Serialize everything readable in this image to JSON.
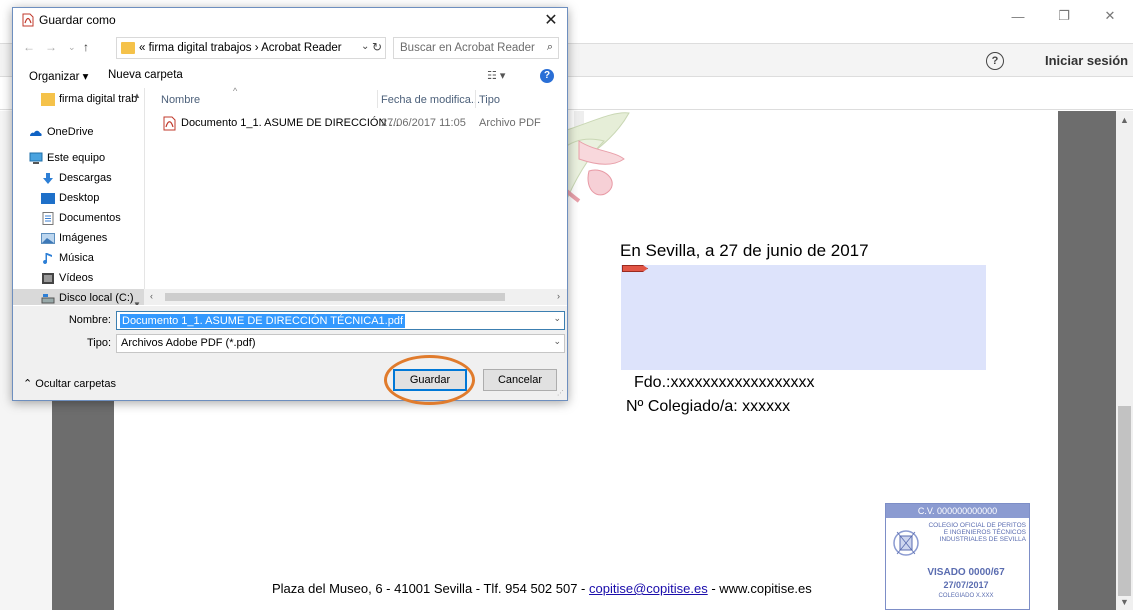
{
  "app": {
    "signin_label": "Iniciar sesión",
    "help_glyph": "?",
    "window_controls": [
      "—",
      "❐",
      "✕"
    ]
  },
  "document": {
    "place_date": "En Sevilla, a 27 de junio de 2017",
    "signature_line": "Fdo.:xxxxxxxxxxxxxxxxxx",
    "colegiado_line": "Nº Colegiado/a: xxxxxx",
    "footer_address": "Plaza del Museo, 6  -  41001 Sevilla  -  Tlf. 954 502 507  - ",
    "footer_email": "copitise@copitise.es",
    "footer_web": " -  www.copitise.es",
    "stamp": {
      "cv": "C.V. 000000000000",
      "college": "COLEGIO OFICIAL DE PERITOS E INGENIEROS TÉCNICOS INDUSTRIALES DE SEVILLA",
      "visado": "VISADO 0000/67",
      "date": "27/07/2017",
      "colegiado": "COLEGIADO X.XXX"
    }
  },
  "dialog": {
    "title": "Guardar como",
    "close_glyph": "✕",
    "path": "«  firma digital trabajos  ›  Acrobat Reader",
    "search_placeholder": "Buscar en Acrobat Reader",
    "organize_label": "Organizar ▾",
    "new_folder_label": "Nueva carpeta",
    "view_label": "☷ ▾",
    "nav_items": [
      {
        "label": "firma digital trab"
      },
      {
        "label": "OneDrive"
      },
      {
        "label": "Este equipo"
      },
      {
        "label": "Descargas"
      },
      {
        "label": "Desktop"
      },
      {
        "label": "Documentos"
      },
      {
        "label": "Imágenes"
      },
      {
        "label": "Música"
      },
      {
        "label": "Vídeos"
      },
      {
        "label": "Disco local (C:)"
      }
    ],
    "columns": {
      "name": "Nombre",
      "date": "Fecha de modifica...",
      "type": "Tipo"
    },
    "files": [
      {
        "name": "Documento 1_1. ASUME DE DIRECCIÓN ...",
        "date": "27/06/2017 11:05",
        "type": "Archivo PDF"
      }
    ],
    "name_label": "Nombre:",
    "name_value": "Documento 1_1. ASUME DE DIRECCIÓN TÉCNICA1.pdf",
    "type_label": "Tipo:",
    "type_value": "Archivos Adobe PDF (*.pdf)",
    "hide_folders_label": "Ocultar carpetas",
    "save_label": "Guardar",
    "cancel_label": "Cancelar"
  },
  "colors": {
    "accent": "#0078d7",
    "highlight_ring": "#e07b2c",
    "selection": "#3399ff"
  }
}
